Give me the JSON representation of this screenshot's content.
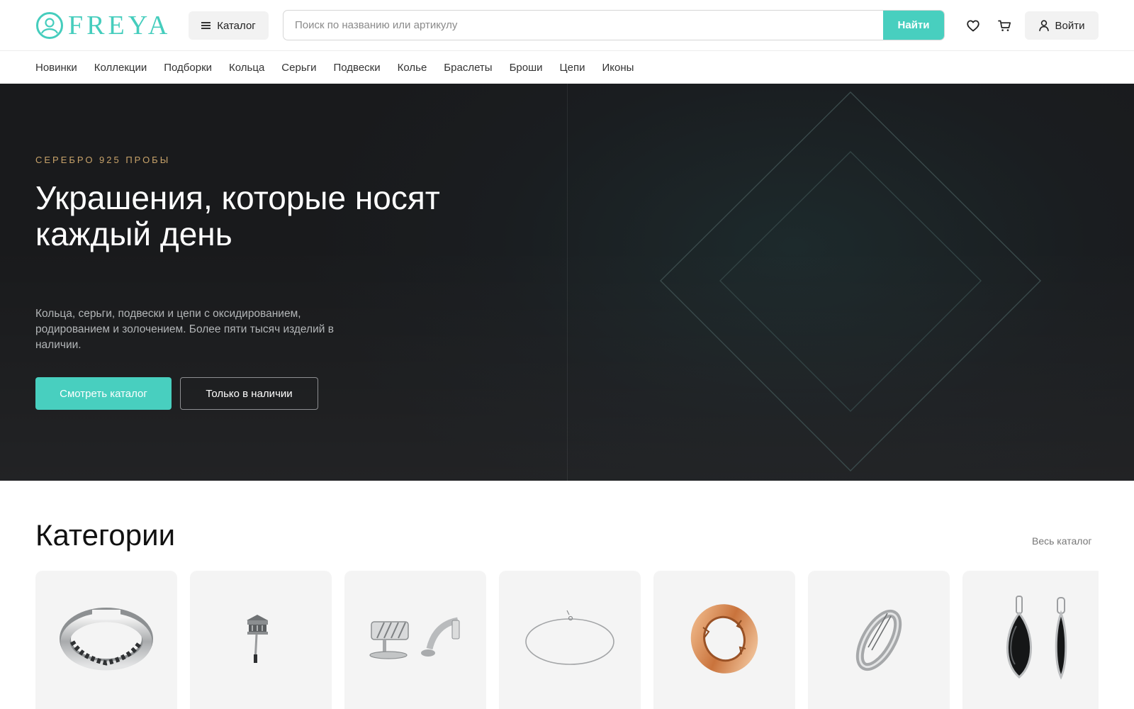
{
  "header": {
    "logo_text": "FREYA",
    "catalog_label": "Каталог",
    "search_placeholder": "Поиск по названию или артикулу",
    "search_button": "Найти",
    "login_label": "Войти",
    "icons": [
      "logo-icon",
      "menu-icon",
      "heart-icon",
      "cart-icon",
      "user-icon"
    ]
  },
  "nav": {
    "items": [
      "Новинки",
      "Коллекции",
      "Подборки",
      "Кольца",
      "Серьги",
      "Подвески",
      "Колье",
      "Браслеты",
      "Броши",
      "Цепи",
      "Иконы"
    ]
  },
  "hero": {
    "eyebrow": "СЕРЕБРО 925 ПРОБЫ",
    "title": "Украшения, которые носят каждый день",
    "description": "Кольца, серьги, подвески и цепи с оксидированием, родированием и золочением. Более пяти тысяч изделий в наличии.",
    "primary_button": "Смотреть каталог",
    "secondary_button": "Только в наличии"
  },
  "categories": {
    "title": "Категории",
    "all_link": "Весь каталог",
    "cards": [
      "bracelet-image",
      "brooch-image",
      "cufflinks-image",
      "chain-image",
      "ring-gold-image",
      "ring-silver-image",
      "pendant-image"
    ]
  },
  "colors": {
    "accent": "#48cfbf",
    "hero_bg": "#1a1b1d",
    "eyebrow": "#c8a36a"
  }
}
